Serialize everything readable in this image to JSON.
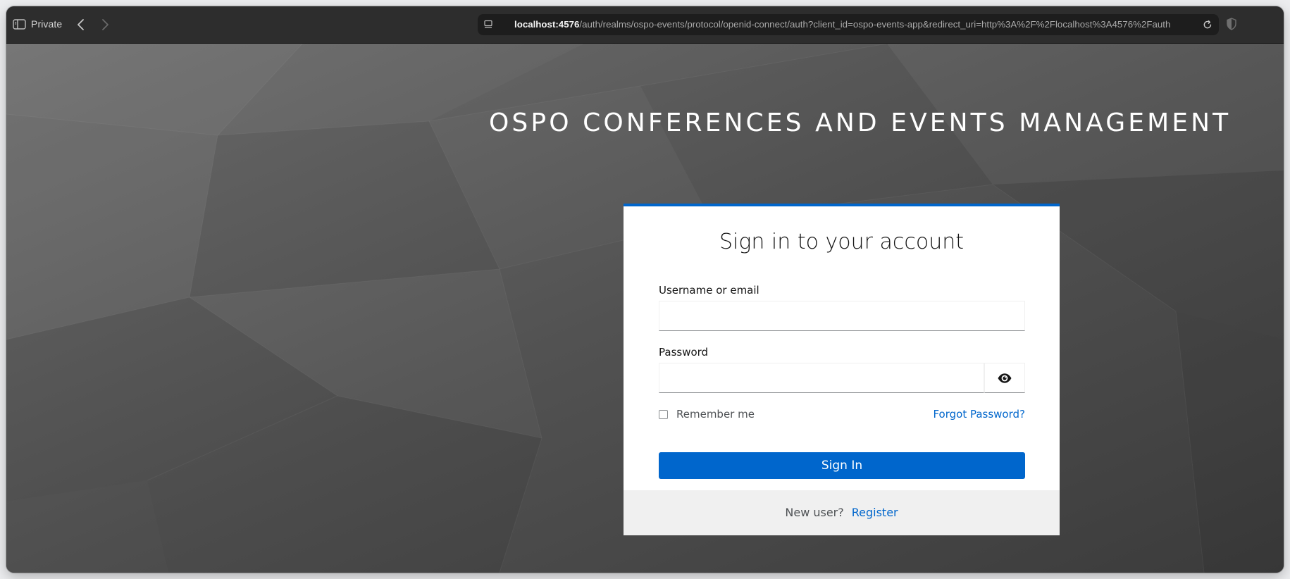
{
  "browser": {
    "private_label": "Private",
    "url_host": "localhost:4576",
    "url_rest": "/auth/realms/ospo-events/protocol/openid-connect/auth?client_id=ospo-events-app&redirect_uri=http%3A%2F%2Flocalhost%3A4576%2Fauth"
  },
  "page": {
    "brand_title": "OSPO CONFERENCES AND EVENTS MANAGEMENT"
  },
  "login": {
    "title": "Sign in to your account",
    "username_label": "Username or email",
    "username_value": "",
    "password_label": "Password",
    "password_value": "",
    "remember_label": "Remember me",
    "remember_checked": false,
    "forgot_label": "Forgot Password?",
    "signin_label": "Sign In",
    "new_user_text": "New user?",
    "register_label": "Register"
  },
  "colors": {
    "accent": "#0066cc",
    "background": "#4f4f4f",
    "card": "#ffffff",
    "footer": "#f0f0f0"
  },
  "icons": {
    "sidebar": "sidebar-icon",
    "back": "chevron-left-icon",
    "forward": "chevron-right-icon",
    "page": "page-icon",
    "reload": "reload-icon",
    "shield": "shield-icon",
    "password_toggle": "eye-icon"
  }
}
